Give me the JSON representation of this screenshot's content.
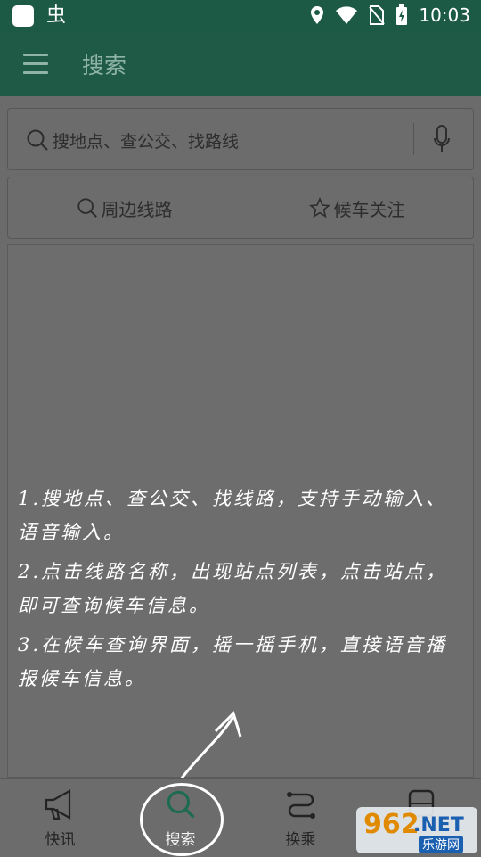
{
  "status_bar": {
    "time": "10:03",
    "app_glyph": "虫"
  },
  "app_bar": {
    "title": "搜索"
  },
  "search": {
    "placeholder": "搜地点、查公交、找路线"
  },
  "tabs": [
    {
      "label": "周边线路",
      "icon": "search-icon"
    },
    {
      "label": "候车关注",
      "icon": "star-icon"
    }
  ],
  "notes": [
    "1.搜地点、查公交、找线路，支持手动输入、语音输入。",
    "2.点击线路名称，出现站点列表，点击站点，即可查询候车信息。",
    "3.在候车查询界面，摇一摇手机，直接语音播报候车信息。"
  ],
  "bottom_nav": [
    {
      "label": "快讯",
      "icon": "megaphone-icon"
    },
    {
      "label": "搜索",
      "icon": "search-icon",
      "active": true
    },
    {
      "label": "换乘",
      "icon": "route-icon"
    },
    {
      "label": "",
      "icon": "bus-icon"
    }
  ],
  "watermark": {
    "big": "962",
    "net": ".NET",
    "cn": "乐游网"
  }
}
